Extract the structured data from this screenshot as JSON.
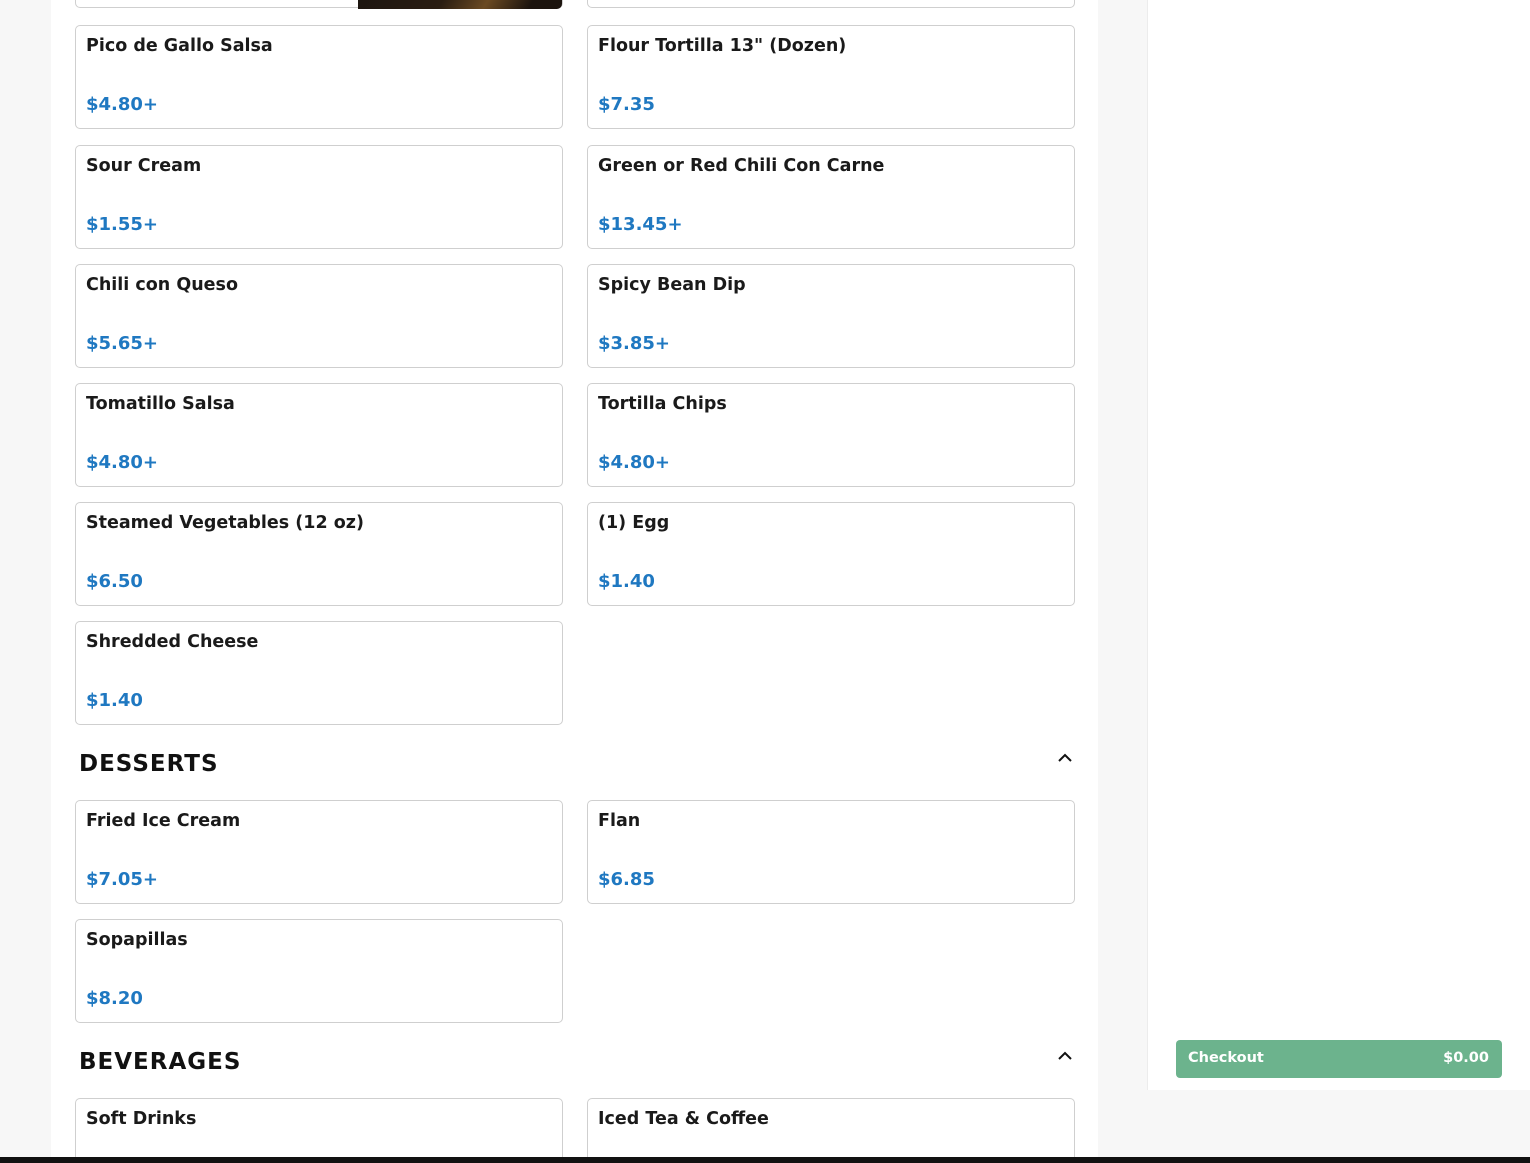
{
  "menu": {
    "sides": [
      {
        "name": "Pico de Gallo Salsa",
        "price": "$4.80+"
      },
      {
        "name": "Flour Tortilla 13\" (Dozen)",
        "price": "$7.35"
      },
      {
        "name": "Sour Cream",
        "price": "$1.55+"
      },
      {
        "name": "Green or Red Chili Con Carne",
        "price": "$13.45+"
      },
      {
        "name": "Chili con Queso",
        "price": "$5.65+"
      },
      {
        "name": "Spicy Bean Dip",
        "price": "$3.85+"
      },
      {
        "name": "Tomatillo Salsa",
        "price": "$4.80+"
      },
      {
        "name": "Tortilla Chips",
        "price": "$4.80+"
      },
      {
        "name": "Steamed Vegetables (12 oz)",
        "price": "$6.50"
      },
      {
        "name": "(1) Egg",
        "price": "$1.40"
      },
      {
        "name": "Shredded Cheese",
        "price": "$1.40"
      }
    ],
    "desserts": {
      "title": "DESSERTS",
      "items": [
        {
          "name": "Fried Ice Cream",
          "price": "$7.05+"
        },
        {
          "name": "Flan",
          "price": "$6.85"
        },
        {
          "name": "Sopapillas",
          "price": "$8.20"
        }
      ]
    },
    "beverages": {
      "title": "BEVERAGES",
      "items": [
        {
          "name": "Soft Drinks"
        },
        {
          "name": "Iced Tea & Coffee"
        }
      ]
    }
  },
  "cart": {
    "checkout_label": "Checkout",
    "total": "$0.00"
  },
  "colors": {
    "price": "#1f78c1",
    "checkout": "#6cb38d"
  },
  "icons": {
    "collapse": "chevron-up-icon"
  }
}
